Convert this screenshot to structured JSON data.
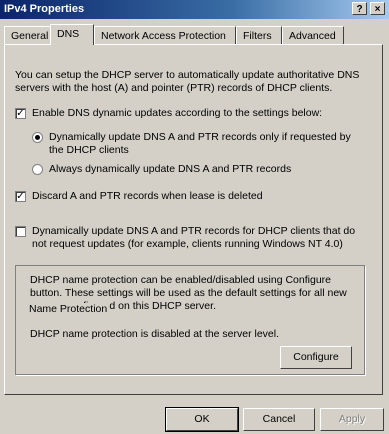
{
  "window": {
    "title": "IPv4 Properties",
    "help_label": "?",
    "close_label": "×"
  },
  "tabs": [
    {
      "label": "General",
      "active": false
    },
    {
      "label": "DNS",
      "active": true
    },
    {
      "label": "Network Access Protection",
      "active": false
    },
    {
      "label": "Filters",
      "active": false
    },
    {
      "label": "Advanced",
      "active": false
    }
  ],
  "dns": {
    "intro_line1": "You can setup the DHCP server to automatically update authoritative DNS",
    "intro_line2": "servers with the host (A) and pointer (PTR) records of DHCP clients.",
    "enable_updates": {
      "label": "Enable DNS dynamic updates according to the settings below:",
      "checked": true
    },
    "radio_requested": {
      "label_line1": "Dynamically update DNS A and PTR records only if requested by",
      "label_line2": "the DHCP clients",
      "selected": true
    },
    "radio_always": {
      "label": "Always dynamically update DNS A and PTR records",
      "selected": false
    },
    "discard_records": {
      "label": "Discard A and PTR records when lease is deleted",
      "checked": true
    },
    "update_nonrequesting": {
      "label_line1": "Dynamically update DNS A and PTR records for DHCP clients that do",
      "label_line2": "not request updates (for example, clients running Windows NT 4.0)",
      "checked": false
    }
  },
  "name_protection": {
    "legend": "Name Protection",
    "desc_line1": "DHCP name protection can be enabled/disabled using Configure",
    "desc_line2": "button. These settings will be used as the default settings for all new",
    "desc_line3": "scopes configured on this DHCP server.",
    "status": "DHCP name protection is disabled at the server level.",
    "configure_label": "Configure"
  },
  "footer": {
    "ok_label": "OK",
    "cancel_label": "Cancel",
    "apply_label": "Apply"
  }
}
